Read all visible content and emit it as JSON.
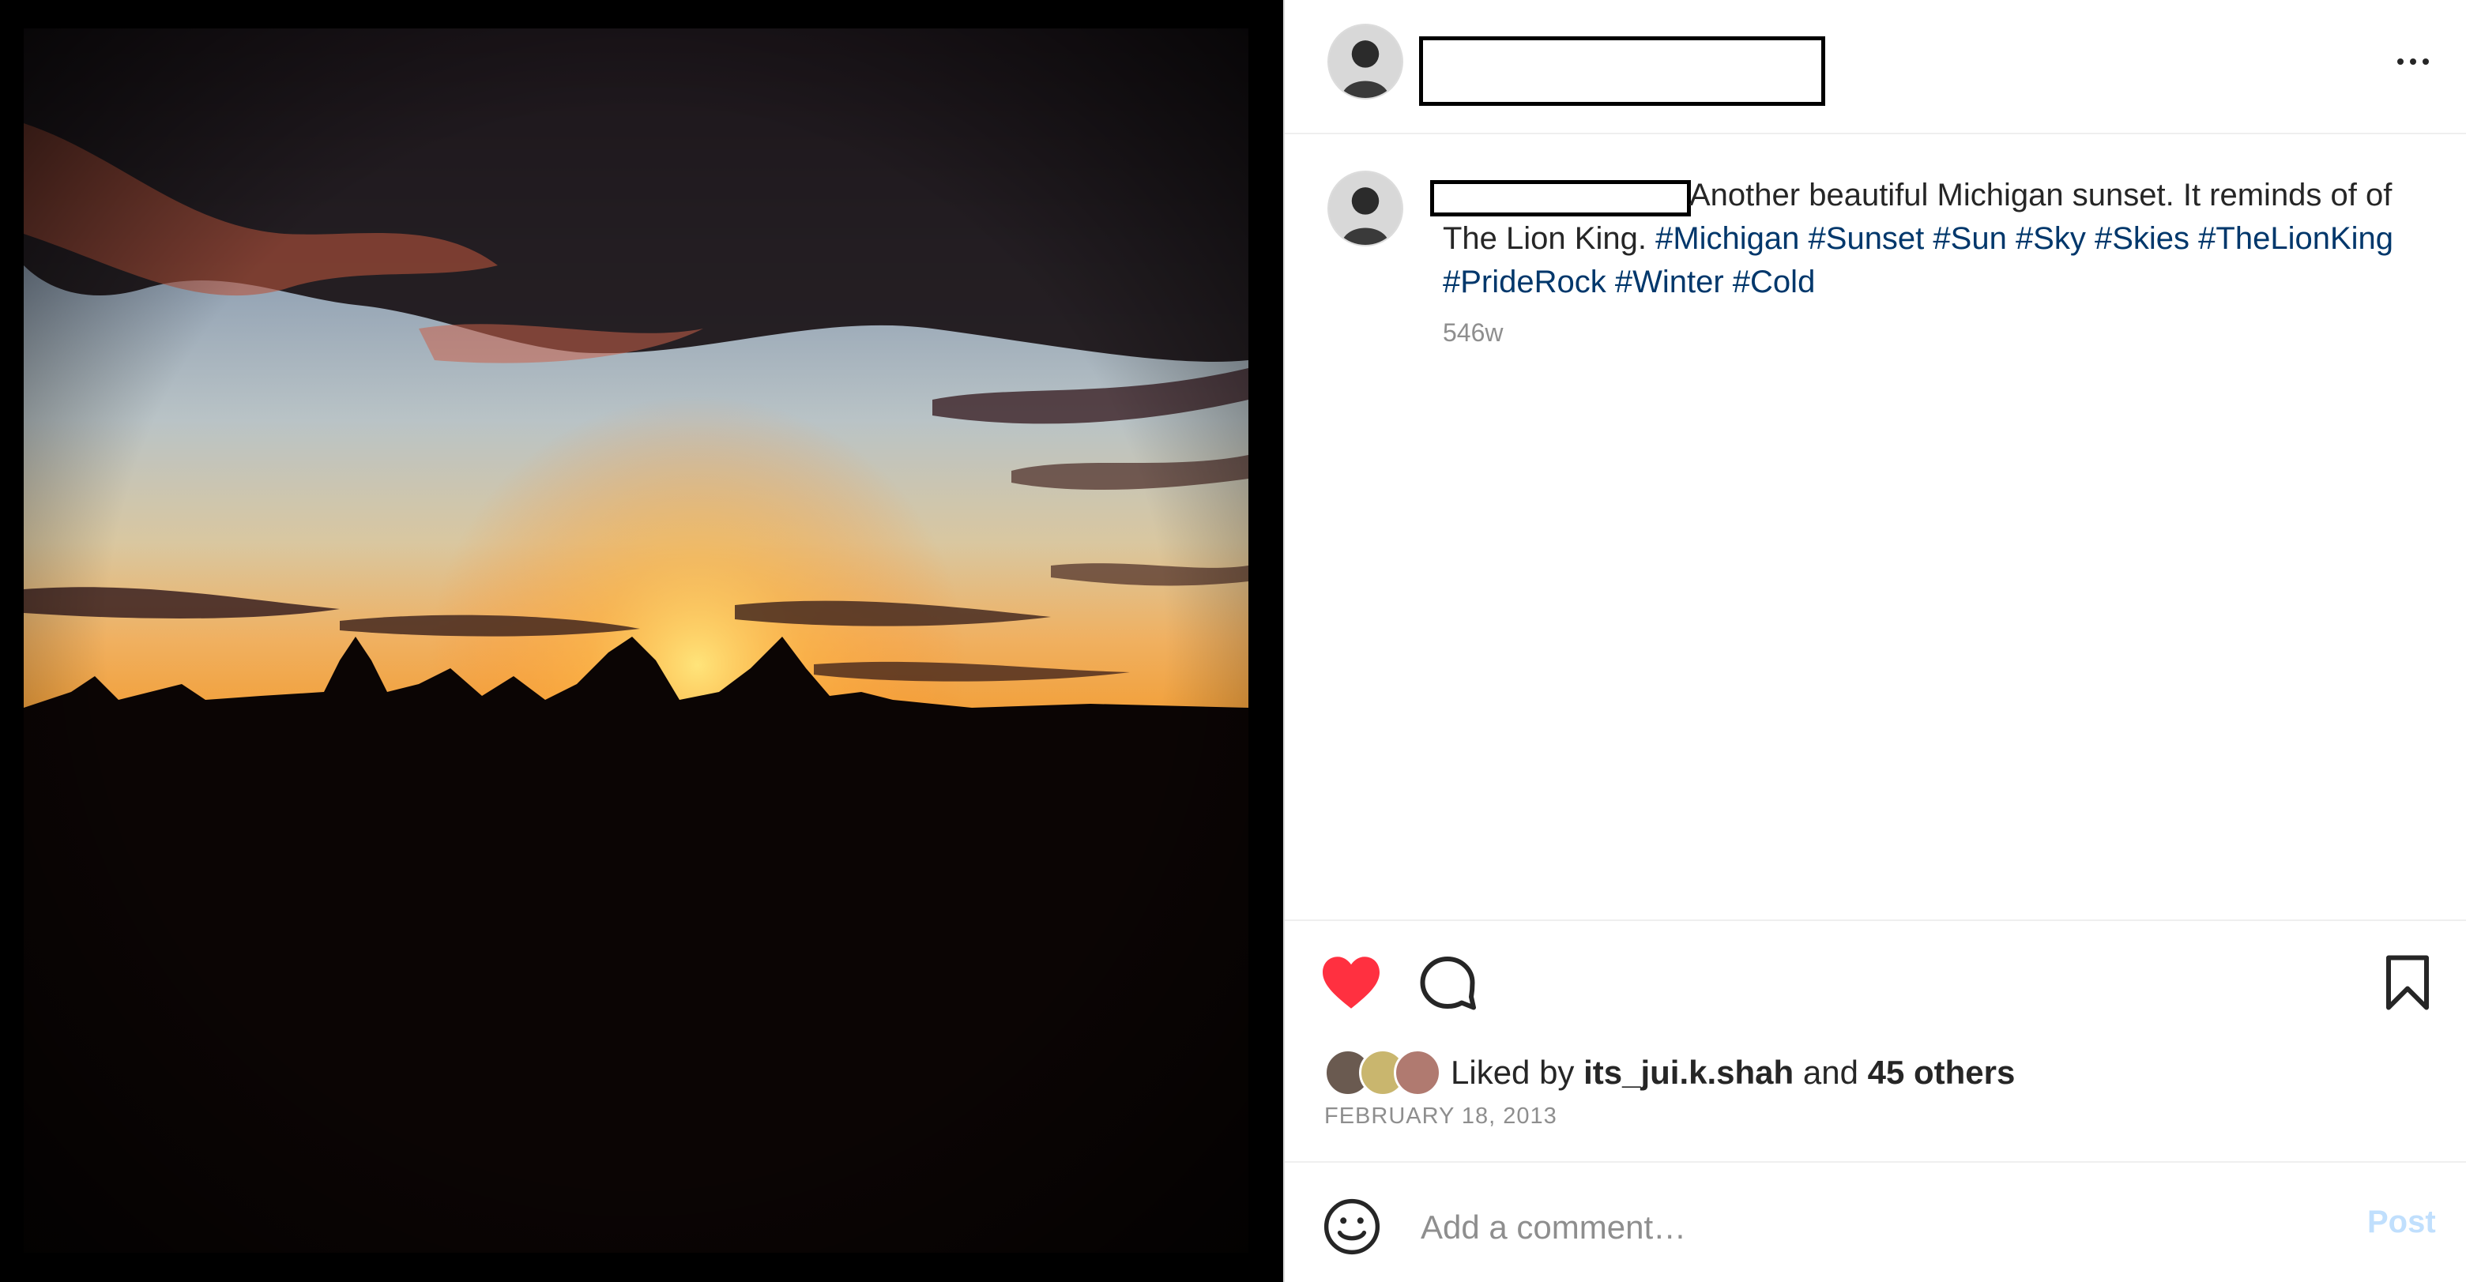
{
  "post": {
    "image_alt": "Sunset over tree silhouettes",
    "caption_text": "Another beautiful Michigan sunset. It reminds of of The Lion King.",
    "caption_hashtags": "#Michigan #Sunset #Sun #Sky #Skies #TheLionKing #PrideRock #Winter #Cold",
    "age": "546w",
    "liked_prefix": "Liked by",
    "liked_user": "its_jui.k.shah",
    "liked_and": "and",
    "liked_others": "45 others",
    "date": "FEBRUARY 18, 2013"
  },
  "comment": {
    "placeholder": "Add a comment…",
    "post_label": "Post"
  },
  "icons": {
    "like": "heart-filled-icon",
    "comment": "comment-bubble-icon",
    "save": "bookmark-icon",
    "more": "more-options-icon",
    "emoji": "emoji-smile-icon"
  },
  "colors": {
    "like_red": "#ff3040",
    "hashtag_blue": "#00376b",
    "post_disabled": "#c0dffd",
    "secondary_text": "#8e8e8e"
  }
}
